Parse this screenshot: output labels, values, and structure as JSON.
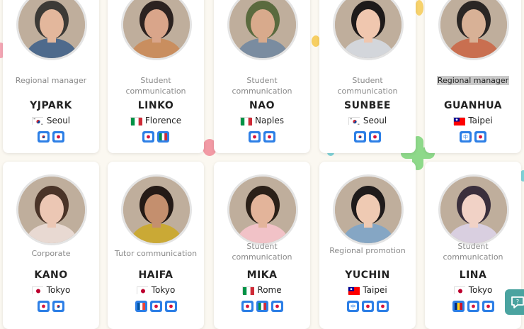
{
  "profiles": [
    {
      "role": "Regional manager",
      "name": "YJPARK",
      "city": "Seoul",
      "flag": "kr",
      "badges": [
        "kr",
        "ja"
      ]
    },
    {
      "role": "Student communication",
      "name": "LINKO",
      "city": "Florence",
      "flag": "it",
      "badges": [
        "ja",
        "it"
      ]
    },
    {
      "role": "Student communication",
      "name": "NAO",
      "city": "Naples",
      "flag": "it",
      "badges": [
        "ja",
        "ja"
      ]
    },
    {
      "role": "Student communication",
      "name": "SUNBEE",
      "city": "Seoul",
      "flag": "kr",
      "badges": [
        "kr",
        "ja"
      ]
    },
    {
      "role": "Regional manager",
      "name": "GUANHUA",
      "city": "Taipei",
      "flag": "tw",
      "badges": [
        "zh",
        "ja"
      ],
      "highlight": true
    },
    {
      "role": "Corporate",
      "name": "KANO",
      "city": "Tokyo",
      "flag": "jp",
      "badges": [
        "ja",
        "kr"
      ]
    },
    {
      "role": "Tutor communication",
      "name": "HAIFA",
      "city": "Tokyo",
      "flag": "jp",
      "badges": [
        "fr",
        "ja",
        "ja"
      ]
    },
    {
      "role": "Student communication",
      "name": "MIKA",
      "city": "Rome",
      "flag": "it",
      "badges": [
        "ja",
        "it",
        "ja"
      ]
    },
    {
      "role": "Regional promotion",
      "name": "YUCHIN",
      "city": "Taipei",
      "flag": "tw",
      "badges": [
        "zh",
        "ja",
        "ja"
      ]
    },
    {
      "role": "Student communication",
      "name": "LINA",
      "city": "Tokyo",
      "flag": "jp",
      "badges": [
        "ro",
        "ja",
        "ja"
      ]
    }
  ],
  "colors": {
    "badge": "#2d7fe6",
    "background": "#fbf8f1",
    "chat": "#4aa3a0"
  },
  "chat_icon": "chat-help-icon"
}
